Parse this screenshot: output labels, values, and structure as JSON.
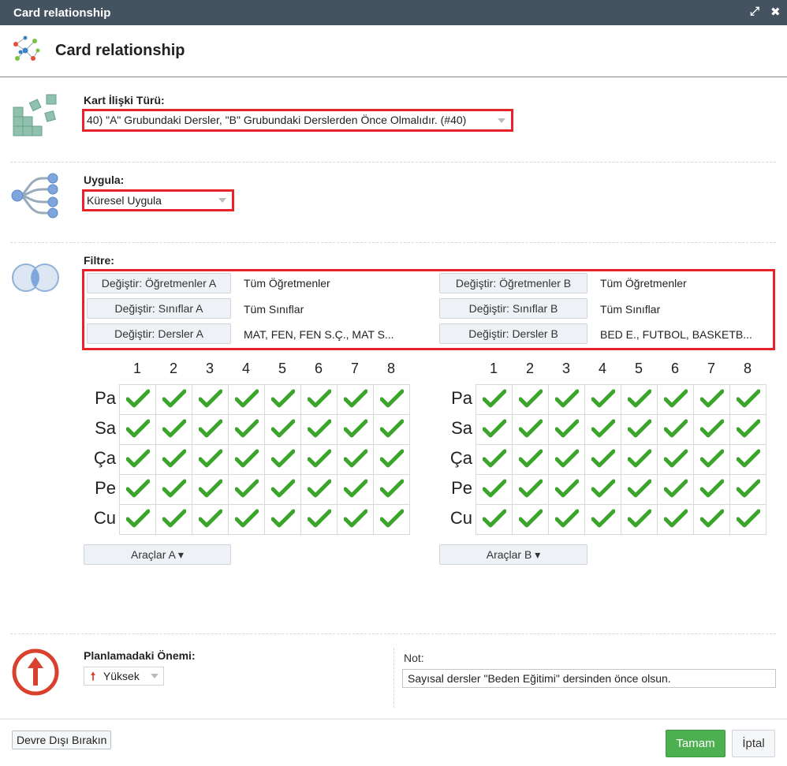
{
  "window": {
    "title": "Card relationship",
    "maximize_icon": "expand-arrows-icon",
    "close_icon": "close-x-icon"
  },
  "header": {
    "heading": "Card relationship"
  },
  "relation_type": {
    "label": "Kart İlişki Türü:",
    "value": "40) \"A\" Grubundaki Dersler, \"B\" Grubundaki Derslerden Önce Olmalıdır. (#40)"
  },
  "apply": {
    "label": "Uygula:",
    "value": "Küresel Uygula"
  },
  "filter": {
    "label": "Filtre:",
    "a": [
      {
        "button": "Değiştir: Öğretmenler A",
        "value": "Tüm Öğretmenler"
      },
      {
        "button": "Değiştir: Sınıflar A",
        "value": "Tüm Sınıflar"
      },
      {
        "button": "Değiştir: Dersler A",
        "value": "MAT, FEN, FEN S.Ç., MAT S..."
      }
    ],
    "b": [
      {
        "button": "Değiştir: Öğretmenler B",
        "value": "Tüm Öğretmenler"
      },
      {
        "button": "Değiştir: Sınıflar B",
        "value": "Tüm Sınıflar"
      },
      {
        "button": "Değiştir: Dersler B",
        "value": "BED E., FUTBOL, BASKETB..."
      }
    ]
  },
  "grid": {
    "periods": [
      "1",
      "2",
      "3",
      "4",
      "5",
      "6",
      "7",
      "8"
    ],
    "days": [
      "Pa",
      "Sa",
      "Ça",
      "Pe",
      "Cu"
    ],
    "cell_icon": "green-checkmark-icon",
    "check_color": "#3aa52a",
    "tools_a": "Araçlar A ▾",
    "tools_b": "Araçlar B ▾"
  },
  "importance": {
    "label": "Planlamadaki Önemi:",
    "value": "Yüksek",
    "icon": "red-up-arrow-icon",
    "color": "#e03a2f"
  },
  "note": {
    "label": "Not:",
    "value": "Sayısal dersler \"Beden Eğitimi\" dersinden önce olsun."
  },
  "footer": {
    "disable": "Devre Dışı Bırakın",
    "ok": "Tamam",
    "cancel": "İptal"
  }
}
